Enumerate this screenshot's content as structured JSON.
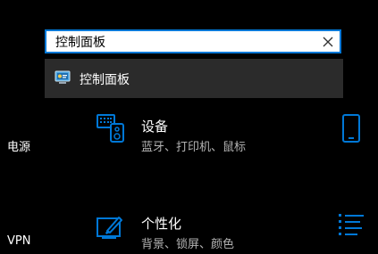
{
  "search": {
    "value": "控制面板"
  },
  "suggestion": {
    "label": "控制面板",
    "icon": "control-panel-icon"
  },
  "left_nav": {
    "power": "电源",
    "vpn": "VPN"
  },
  "tiles": [
    {
      "title": "设备",
      "description": "蓝牙、打印机、鼠标",
      "icon": "devices-icon"
    },
    {
      "title": "个性化",
      "description": "背景、锁屏、颜色",
      "icon": "personalization-icon"
    }
  ],
  "right_icons": [
    "phone-icon",
    "apps-list-icon"
  ],
  "colors": {
    "accent": "#0078d7",
    "background": "#000000",
    "dropdown": "#2b2b2b",
    "secondary_text": "#b3b3b3"
  }
}
